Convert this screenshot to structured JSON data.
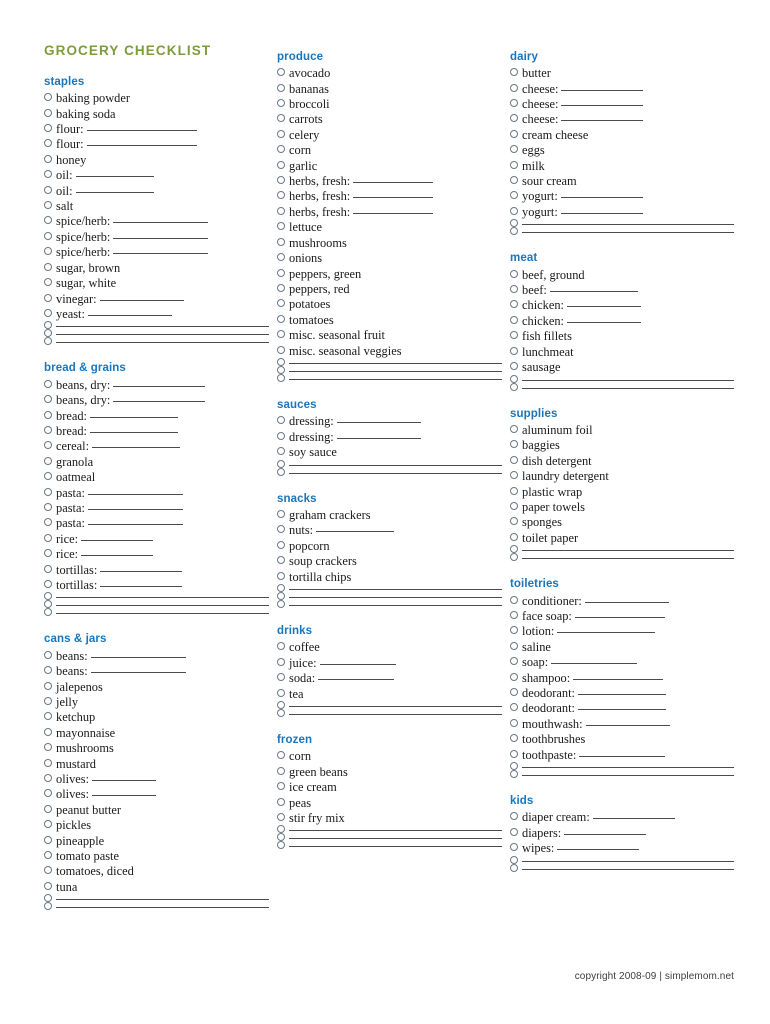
{
  "document": {
    "title": "GROCERY CHECKLIST",
    "footer": "copyright 2008-09 | simplemom.net",
    "colors": {
      "title": "#7d9c3c",
      "section_header": "#1b75bb",
      "item_text": "#1a1a1a",
      "rule": "#4a4a4a",
      "bullet_border": "#6a7884",
      "background": "#ffffff"
    }
  },
  "columns": [
    {
      "name": "column-1",
      "sections": [
        {
          "header": "staples",
          "items": [
            {
              "label": "baking powder",
              "rule": 0
            },
            {
              "label": "baking soda",
              "rule": 0
            },
            {
              "label": "flour:",
              "rule": 110
            },
            {
              "label": "flour:",
              "rule": 110
            },
            {
              "label": "honey",
              "rule": 0
            },
            {
              "label": "oil:",
              "rule": 78
            },
            {
              "label": "oil:",
              "rule": 78
            },
            {
              "label": "salt",
              "rule": 0
            },
            {
              "label": "spice/herb:",
              "rule": 95
            },
            {
              "label": "spice/herb:",
              "rule": 95
            },
            {
              "label": "spice/herb:",
              "rule": 95
            },
            {
              "label": "sugar, brown",
              "rule": 0
            },
            {
              "label": "sugar, white",
              "rule": 0
            },
            {
              "label": "vinegar:",
              "rule": 84
            },
            {
              "label": "yeast:",
              "rule": 84
            },
            {
              "label": "",
              "rule": -1
            },
            {
              "label": "",
              "rule": -1
            },
            {
              "label": "",
              "rule": -1
            }
          ]
        },
        {
          "header": "bread & grains",
          "items": [
            {
              "label": "beans, dry:",
              "rule": 92
            },
            {
              "label": "beans, dry:",
              "rule": 92
            },
            {
              "label": "bread:",
              "rule": 88
            },
            {
              "label": "bread:",
              "rule": 88
            },
            {
              "label": "cereal:",
              "rule": 88
            },
            {
              "label": "granola",
              "rule": 0
            },
            {
              "label": "oatmeal",
              "rule": 0
            },
            {
              "label": "pasta:",
              "rule": 95
            },
            {
              "label": "pasta:",
              "rule": 95
            },
            {
              "label": "pasta:",
              "rule": 95
            },
            {
              "label": "rice:",
              "rule": 72
            },
            {
              "label": "rice:",
              "rule": 72
            },
            {
              "label": "tortillas:",
              "rule": 82
            },
            {
              "label": "tortillas:",
              "rule": 82
            },
            {
              "label": "",
              "rule": -1
            },
            {
              "label": "",
              "rule": -1
            },
            {
              "label": "",
              "rule": -1
            }
          ]
        },
        {
          "header": "cans & jars",
          "items": [
            {
              "label": "beans:",
              "rule": 95
            },
            {
              "label": "beans:",
              "rule": 95
            },
            {
              "label": "jalepenos",
              "rule": 0
            },
            {
              "label": "jelly",
              "rule": 0
            },
            {
              "label": "ketchup",
              "rule": 0
            },
            {
              "label": "mayonnaise",
              "rule": 0
            },
            {
              "label": "mushrooms",
              "rule": 0
            },
            {
              "label": "mustard",
              "rule": 0
            },
            {
              "label": "olives:",
              "rule": 64
            },
            {
              "label": "olives:",
              "rule": 64
            },
            {
              "label": "peanut butter",
              "rule": 0
            },
            {
              "label": "pickles",
              "rule": 0
            },
            {
              "label": "pineapple",
              "rule": 0
            },
            {
              "label": "tomato paste",
              "rule": 0
            },
            {
              "label": "tomatoes, diced",
              "rule": 0
            },
            {
              "label": "tuna",
              "rule": 0
            },
            {
              "label": "",
              "rule": -1
            },
            {
              "label": "",
              "rule": -1
            }
          ]
        }
      ]
    },
    {
      "name": "column-2",
      "sections": [
        {
          "header": "produce",
          "items": [
            {
              "label": "avocado",
              "rule": 0
            },
            {
              "label": "bananas",
              "rule": 0
            },
            {
              "label": "broccoli",
              "rule": 0
            },
            {
              "label": "carrots",
              "rule": 0
            },
            {
              "label": "celery",
              "rule": 0
            },
            {
              "label": "corn",
              "rule": 0
            },
            {
              "label": "garlic",
              "rule": 0
            },
            {
              "label": "herbs, fresh:",
              "rule": 80
            },
            {
              "label": "herbs, fresh:",
              "rule": 80
            },
            {
              "label": "herbs, fresh:",
              "rule": 80
            },
            {
              "label": "lettuce",
              "rule": 0
            },
            {
              "label": "mushrooms",
              "rule": 0
            },
            {
              "label": "onions",
              "rule": 0
            },
            {
              "label": "peppers, green",
              "rule": 0
            },
            {
              "label": "peppers, red",
              "rule": 0
            },
            {
              "label": "potatoes",
              "rule": 0
            },
            {
              "label": "tomatoes",
              "rule": 0
            },
            {
              "label": "misc. seasonal fruit",
              "rule": 0
            },
            {
              "label": "misc. seasonal veggies",
              "rule": 0
            },
            {
              "label": "",
              "rule": -1
            },
            {
              "label": "",
              "rule": -1
            },
            {
              "label": "",
              "rule": -1
            }
          ]
        },
        {
          "header": "sauces",
          "items": [
            {
              "label": "dressing:",
              "rule": 84
            },
            {
              "label": "dressing:",
              "rule": 84
            },
            {
              "label": "soy sauce",
              "rule": 0
            },
            {
              "label": "",
              "rule": -1
            },
            {
              "label": "",
              "rule": -1
            }
          ]
        },
        {
          "header": "snacks",
          "items": [
            {
              "label": "graham crackers",
              "rule": 0
            },
            {
              "label": "nuts:",
              "rule": 78
            },
            {
              "label": "popcorn",
              "rule": 0
            },
            {
              "label": "soup crackers",
              "rule": 0
            },
            {
              "label": "tortilla chips",
              "rule": 0
            },
            {
              "label": "",
              "rule": -1
            },
            {
              "label": "",
              "rule": -1
            },
            {
              "label": "",
              "rule": -1
            }
          ]
        },
        {
          "header": "drinks",
          "items": [
            {
              "label": "coffee",
              "rule": 0
            },
            {
              "label": "juice:",
              "rule": 76
            },
            {
              "label": "soda:",
              "rule": 76
            },
            {
              "label": "tea",
              "rule": 0
            },
            {
              "label": "",
              "rule": -1
            },
            {
              "label": "",
              "rule": -1
            }
          ]
        },
        {
          "header": "frozen",
          "items": [
            {
              "label": "corn",
              "rule": 0
            },
            {
              "label": "green beans",
              "rule": 0
            },
            {
              "label": "ice cream",
              "rule": 0
            },
            {
              "label": "peas",
              "rule": 0
            },
            {
              "label": "stir fry mix",
              "rule": 0
            },
            {
              "label": "",
              "rule": -1
            },
            {
              "label": "",
              "rule": -1
            },
            {
              "label": "",
              "rule": -1
            }
          ]
        }
      ]
    },
    {
      "name": "column-3",
      "sections": [
        {
          "header": "dairy",
          "items": [
            {
              "label": "butter",
              "rule": 0
            },
            {
              "label": "cheese:",
              "rule": 82
            },
            {
              "label": "cheese:",
              "rule": 82
            },
            {
              "label": "cheese:",
              "rule": 82
            },
            {
              "label": "cream cheese",
              "rule": 0
            },
            {
              "label": "eggs",
              "rule": 0
            },
            {
              "label": "milk",
              "rule": 0
            },
            {
              "label": "sour cream",
              "rule": 0
            },
            {
              "label": "yogurt:",
              "rule": 82
            },
            {
              "label": "yogurt:",
              "rule": 82
            },
            {
              "label": "",
              "rule": -1
            },
            {
              "label": "",
              "rule": -1
            }
          ]
        },
        {
          "header": "meat",
          "items": [
            {
              "label": "beef, ground",
              "rule": 0
            },
            {
              "label": "beef:",
              "rule": 88
            },
            {
              "label": "chicken:",
              "rule": 74
            },
            {
              "label": "chicken:",
              "rule": 74
            },
            {
              "label": "fish fillets",
              "rule": 0
            },
            {
              "label": "lunchmeat",
              "rule": 0
            },
            {
              "label": "sausage",
              "rule": 0
            },
            {
              "label": "",
              "rule": -1
            },
            {
              "label": "",
              "rule": -1
            }
          ]
        },
        {
          "header": "supplies",
          "items": [
            {
              "label": "aluminum foil",
              "rule": 0
            },
            {
              "label": "baggies",
              "rule": 0
            },
            {
              "label": "dish detergent",
              "rule": 0
            },
            {
              "label": "laundry detergent",
              "rule": 0
            },
            {
              "label": "plastic wrap",
              "rule": 0
            },
            {
              "label": "paper towels",
              "rule": 0
            },
            {
              "label": "sponges",
              "rule": 0
            },
            {
              "label": "toilet paper",
              "rule": 0
            },
            {
              "label": "",
              "rule": -1
            },
            {
              "label": "",
              "rule": -1
            }
          ]
        },
        {
          "header": "toiletries",
          "items": [
            {
              "label": "conditioner:",
              "rule": 84
            },
            {
              "label": "face soap:",
              "rule": 90
            },
            {
              "label": "lotion:",
              "rule": 98
            },
            {
              "label": "saline",
              "rule": 0
            },
            {
              "label": "soap:",
              "rule": 86
            },
            {
              "label": "shampoo:",
              "rule": 90
            },
            {
              "label": "deodorant:",
              "rule": 88
            },
            {
              "label": "deodorant:",
              "rule": 88
            },
            {
              "label": "mouthwash:",
              "rule": 84
            },
            {
              "label": "toothbrushes",
              "rule": 0
            },
            {
              "label": "toothpaste:",
              "rule": 86
            },
            {
              "label": "",
              "rule": -1
            },
            {
              "label": "",
              "rule": -1
            }
          ]
        },
        {
          "header": "kids",
          "items": [
            {
              "label": "diaper cream:",
              "rule": 82
            },
            {
              "label": "diapers:",
              "rule": 82
            },
            {
              "label": "wipes:",
              "rule": 82
            },
            {
              "label": "",
              "rule": -1
            },
            {
              "label": "",
              "rule": -1
            }
          ]
        }
      ]
    }
  ]
}
